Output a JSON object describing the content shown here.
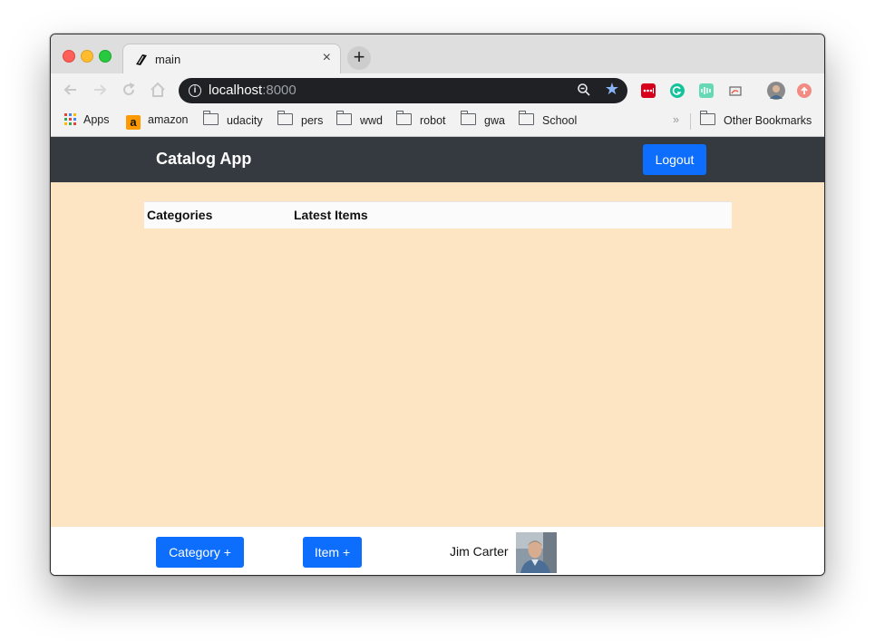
{
  "browser": {
    "tab_title": "main",
    "tab_close": "×",
    "new_tab": "+",
    "url_host": "localhost",
    "url_port": ":8000",
    "bookmarks": [
      {
        "label": "Apps",
        "icon": "apps-grid-icon"
      },
      {
        "label": "amazon",
        "icon": "amazon-icon"
      },
      {
        "label": "udacity",
        "icon": "folder-icon"
      },
      {
        "label": "pers",
        "icon": "folder-icon"
      },
      {
        "label": "wwd",
        "icon": "folder-icon"
      },
      {
        "label": "robot",
        "icon": "folder-icon"
      },
      {
        "label": "gwa",
        "icon": "folder-icon"
      },
      {
        "label": "School",
        "icon": "folder-icon"
      }
    ],
    "overflow": "»",
    "other_bookmarks": "Other Bookmarks"
  },
  "app": {
    "brand": "Catalog App",
    "logout_label": "Logout",
    "columns": {
      "categories": "Categories",
      "latest_items": "Latest Items"
    },
    "footer": {
      "category_button": "Category +",
      "item_button": "Item +",
      "user_name": "Jim Carter"
    }
  },
  "colors": {
    "navbar": "#343a40",
    "page_background": "#fde4c3",
    "button_primary": "#0d6efd"
  }
}
